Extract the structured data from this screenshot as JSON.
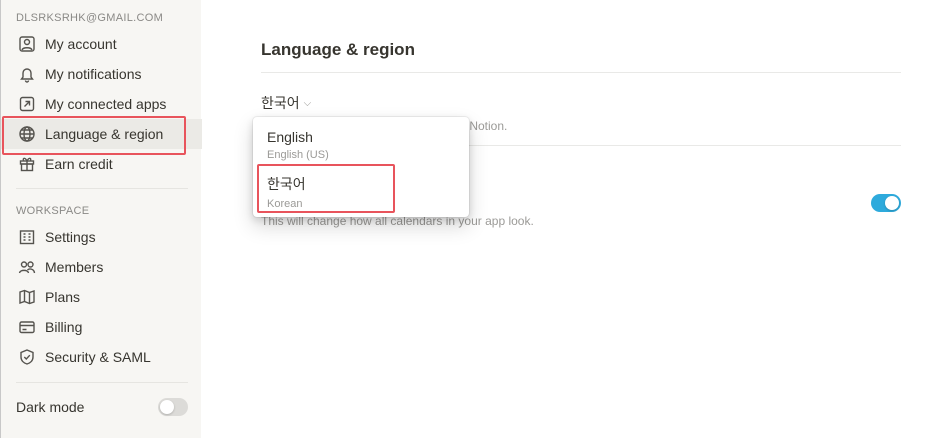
{
  "account": {
    "email": "DLSRKSRHK@GMAIL.COM"
  },
  "sidebar": {
    "personal_items": [
      {
        "label": "My account",
        "icon": "account-icon"
      },
      {
        "label": "My notifications",
        "icon": "bell-icon"
      },
      {
        "label": "My connected apps",
        "icon": "arrow-square-icon"
      },
      {
        "label": "Language & region",
        "icon": "globe-icon",
        "active": true
      },
      {
        "label": "Earn credit",
        "icon": "gift-icon"
      }
    ],
    "workspace_label": "WORKSPACE",
    "workspace_items": [
      {
        "label": "Settings",
        "icon": "building-icon"
      },
      {
        "label": "Members",
        "icon": "members-icon"
      },
      {
        "label": "Plans",
        "icon": "map-icon"
      },
      {
        "label": "Billing",
        "icon": "card-icon"
      },
      {
        "label": "Security & SAML",
        "icon": "shield-icon"
      }
    ],
    "dark_mode": {
      "label": "Dark mode",
      "enabled": false
    }
  },
  "main": {
    "title": "Language & region",
    "language_select": {
      "value": "한국어"
    },
    "language_desc_visible": "th Notion.",
    "calendar_desc": "This will change how all calendars in your app look.",
    "calendar_toggle": {
      "enabled": true
    }
  },
  "dropdown": {
    "options": [
      {
        "name": "English",
        "sub": "English (US)"
      },
      {
        "name": "한국어",
        "sub": "Korean",
        "highlighted": true
      }
    ]
  },
  "colors": {
    "accent": "#2eaadc",
    "highlight": "#e8545c",
    "sidebar_bg": "#f7f6f3"
  }
}
